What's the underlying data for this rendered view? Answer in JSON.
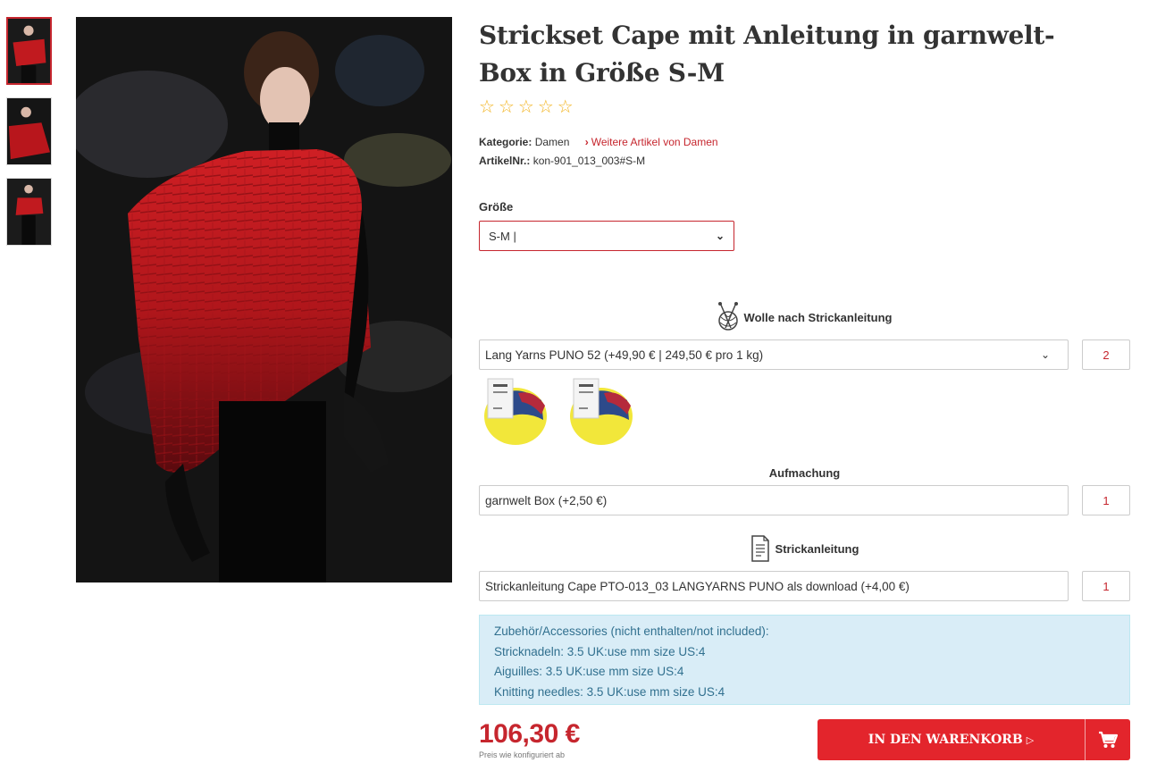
{
  "product": {
    "title": "Strickset Cape mit Anleitung in garnwelt-Box in Größe S-M",
    "rating_stars": 5,
    "rating_value": 0,
    "category_label": "Kategorie:",
    "category_value": "Damen",
    "more_link": "Weitere Artikel von Damen",
    "article_label": "ArtikelNr.:",
    "article_value": "kon-901_013_003#S-M"
  },
  "size": {
    "label": "Größe",
    "value": "S-M |"
  },
  "wool": {
    "heading": "Wolle nach Strickanleitung",
    "selected": "Lang Yarns PUNO 52 (+49,90 € | 249,50 € pro 1 kg)",
    "qty": "2",
    "icon": "yarn-ball-icon"
  },
  "packaging": {
    "heading": "Aufmachung",
    "selected": "garnwelt Box (+2,50 €)",
    "qty": "1"
  },
  "pattern": {
    "heading": "Strickanleitung",
    "selected": "Strickanleitung Cape PTO-013_03 LANGYARNS PUNO als download (+4,00 €)",
    "qty": "1",
    "icon": "document-icon"
  },
  "accessories": {
    "lines": [
      "Zubehör/Accessories (nicht enthalten/not included):",
      "Stricknadeln: 3.5 UK:use mm size US:4",
      "Aiguilles: 3.5 UK:use mm size US:4",
      "Knitting needles: 3.5 UK:use mm size US:4"
    ]
  },
  "price": {
    "value": "106,30 €",
    "note": "Preis wie konfiguriert ab"
  },
  "cart": {
    "label": "IN DEN WARENKORB",
    "icon": "cart-icon"
  },
  "colors": {
    "accent": "#c6262e",
    "button": "#e3252c",
    "star": "#f2b21b",
    "info_bg": "#d9edf7",
    "info_text": "#31708f"
  }
}
